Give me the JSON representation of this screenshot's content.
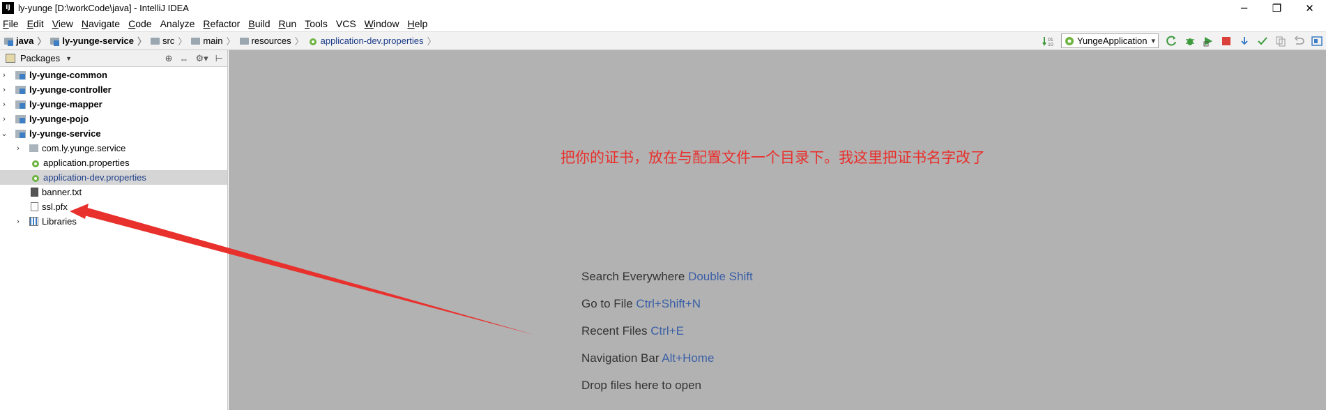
{
  "window": {
    "title": "ly-yunge [D:\\workCode\\java] - IntelliJ IDEA",
    "logo_text": "IJ",
    "controls": {
      "minimize": "─",
      "restore": "❐",
      "close": "✕"
    }
  },
  "menubar": {
    "items": [
      {
        "u": "F",
        "rest": "ile"
      },
      {
        "u": "E",
        "rest": "dit"
      },
      {
        "u": "V",
        "rest": "iew"
      },
      {
        "u": "N",
        "rest": "avigate"
      },
      {
        "u": "C",
        "rest": "ode"
      },
      {
        "u": "",
        "rest": "Analyze"
      },
      {
        "u": "R",
        "rest": "efactor"
      },
      {
        "u": "B",
        "rest": "uild"
      },
      {
        "u": "R",
        "rest": "un"
      },
      {
        "u": "T",
        "rest": "ools"
      },
      {
        "u": "",
        "rest": "VCS"
      },
      {
        "u": "W",
        "rest": "indow"
      },
      {
        "u": "H",
        "rest": "elp"
      }
    ]
  },
  "breadcrumb": {
    "items": [
      "java",
      "ly-yunge-service",
      "src",
      "main",
      "resources",
      "application-dev.properties"
    ]
  },
  "toolbar": {
    "run_config": "YungeApplication"
  },
  "project_panel": {
    "title": "Packages",
    "tree": [
      {
        "label": "ly-yunge-common",
        "kind": "module",
        "expanded": false
      },
      {
        "label": "ly-yunge-controller",
        "kind": "module",
        "expanded": false
      },
      {
        "label": "ly-yunge-mapper",
        "kind": "module",
        "expanded": false
      },
      {
        "label": "ly-yunge-pojo",
        "kind": "module",
        "expanded": false
      },
      {
        "label": "ly-yunge-service",
        "kind": "module",
        "expanded": true
      },
      {
        "label": "com.ly.yunge.service",
        "kind": "package"
      },
      {
        "label": "application.properties",
        "kind": "properties"
      },
      {
        "label": "application-dev.properties",
        "kind": "properties",
        "selected": true
      },
      {
        "label": "banner.txt",
        "kind": "text"
      },
      {
        "label": "ssl.pfx",
        "kind": "file"
      },
      {
        "label": "Libraries",
        "kind": "libraries"
      }
    ]
  },
  "editor": {
    "annotation": "把你的证书，放在与配置文件一个目录下。我这里把证书名字改了",
    "annotation_color": "#e8302c",
    "hints": [
      {
        "text": "Search Everywhere ",
        "key": "Double Shift"
      },
      {
        "text": "Go to File ",
        "key": "Ctrl+Shift+N"
      },
      {
        "text": "Recent Files ",
        "key": "Ctrl+E"
      },
      {
        "text": "Navigation Bar ",
        "key": "Alt+Home"
      },
      {
        "text": "Drop files here to open",
        "key": ""
      }
    ]
  },
  "colors": {
    "editor_bg": "#b2b2b2",
    "key_blue": "#3b5fa6",
    "selection": "#d5d5d5",
    "arrow_red": "#e8302c"
  }
}
